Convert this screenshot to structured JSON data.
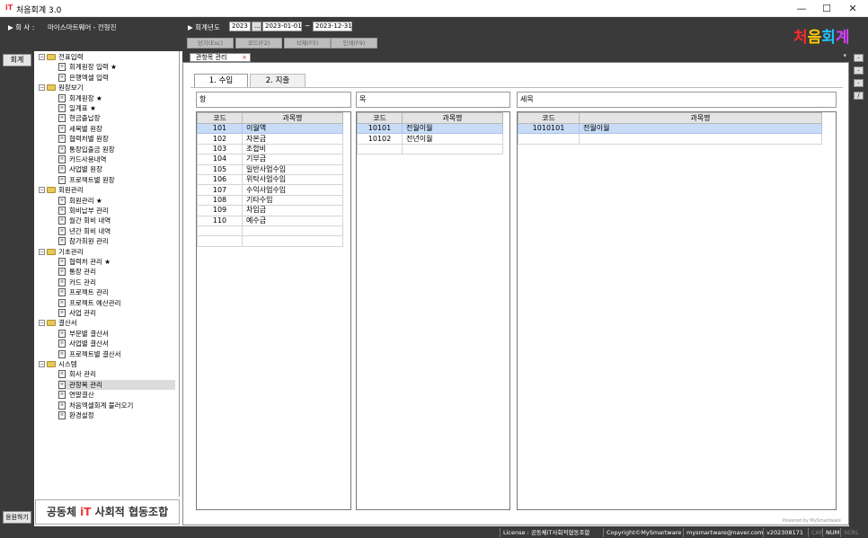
{
  "titlebar": {
    "title": "처음회계 3.0",
    "minimize": "—",
    "maximize": "☐",
    "close": "✕"
  },
  "header": {
    "company_label": "▶ 회 사 : ",
    "company_name": "마이스마트웨어 - 전형진",
    "fiscal_label": "▶ 회계년도",
    "year": "2023",
    "picker": "...",
    "date_from": "2023-01-01",
    "tilde": "~",
    "date_to": "2023-12-31",
    "buttons": {
      "close": "닫기(Esc)",
      "code": "코드(F2)",
      "delete": "삭제(F5)",
      "print": "인쇄(F9)"
    },
    "logo": [
      "처",
      "음",
      "회",
      "계"
    ],
    "logo_colors": [
      "#ff2a2a",
      "#ffcc00",
      "#22c1ff",
      "#d040ff"
    ]
  },
  "leftbar": {
    "tab_accounting": "회계",
    "support_button": "응원하기"
  },
  "tree": {
    "nodes": [
      {
        "label": "전표입력",
        "type": "folder"
      },
      {
        "label": "회계원장 입력 ★",
        "type": "item"
      },
      {
        "label": "은행엑셀 입력",
        "type": "item"
      },
      {
        "label": "원장보기",
        "type": "folder"
      },
      {
        "label": "회계원장 ★",
        "type": "item"
      },
      {
        "label": "일계표 ★",
        "type": "item"
      },
      {
        "label": "현금출납장",
        "type": "item"
      },
      {
        "label": "세목별 원장",
        "type": "item"
      },
      {
        "label": "협력처별 원장",
        "type": "item"
      },
      {
        "label": "통장입출금 원장",
        "type": "item"
      },
      {
        "label": "카드사용내역",
        "type": "item"
      },
      {
        "label": "사업별 원장",
        "type": "item"
      },
      {
        "label": "프로젝트별 원장",
        "type": "item"
      },
      {
        "label": "회원관리",
        "type": "folder"
      },
      {
        "label": "회원관리 ★",
        "type": "item"
      },
      {
        "label": "회비납부 관리",
        "type": "item"
      },
      {
        "label": "월간 회비 내역",
        "type": "item"
      },
      {
        "label": "년간 회비 내역",
        "type": "item"
      },
      {
        "label": "참가회원 관리",
        "type": "item"
      },
      {
        "label": "기초관리",
        "type": "folder"
      },
      {
        "label": "협력처 관리 ★",
        "type": "item"
      },
      {
        "label": "통장 관리",
        "type": "item"
      },
      {
        "label": "카드 관리",
        "type": "item"
      },
      {
        "label": "프로젝트 관리",
        "type": "item"
      },
      {
        "label": "프로젝트 예산관리",
        "type": "item"
      },
      {
        "label": "사업 관리",
        "type": "item"
      },
      {
        "label": "결산서",
        "type": "folder"
      },
      {
        "label": "부문별 결산서",
        "type": "item"
      },
      {
        "label": "사업별 결산서",
        "type": "item"
      },
      {
        "label": "프로젝트별 결산서",
        "type": "item"
      },
      {
        "label": "시스템",
        "type": "folder"
      },
      {
        "label": "회사 관리",
        "type": "item"
      },
      {
        "label": "관항목 관리",
        "type": "item",
        "selected": true
      },
      {
        "label": "연말결산",
        "type": "item"
      },
      {
        "label": "처음엑셀회계 불러오기",
        "type": "item"
      },
      {
        "label": "환경설정",
        "type": "item"
      }
    ]
  },
  "banner": {
    "pre": "공동체 ",
    "it": "iT",
    "post": " 사회적 협동조합"
  },
  "doc_tab": {
    "label": "관항목 관리",
    "close": "×"
  },
  "right_buttons": [
    "-",
    "-",
    "-",
    "/"
  ],
  "subtabs": [
    "1. 수입",
    "2. 지출"
  ],
  "sections": {
    "hang": "항",
    "mok": "목",
    "semok": "세목"
  },
  "grid_headers": {
    "code": "코드",
    "name": "과목명"
  },
  "hang_rows": [
    {
      "code": "101",
      "name": "이월액"
    },
    {
      "code": "102",
      "name": "자본금"
    },
    {
      "code": "103",
      "name": "조합비"
    },
    {
      "code": "104",
      "name": "기부금"
    },
    {
      "code": "105",
      "name": "일반사업수입"
    },
    {
      "code": "106",
      "name": "위탁사업수입"
    },
    {
      "code": "107",
      "name": "수익사업수입"
    },
    {
      "code": "108",
      "name": "기타수입"
    },
    {
      "code": "109",
      "name": "차입금"
    },
    {
      "code": "110",
      "name": "예수금"
    }
  ],
  "mok_rows": [
    {
      "code": "10101",
      "name": "전월이월"
    },
    {
      "code": "10102",
      "name": "전년이월"
    }
  ],
  "semok_rows": [
    {
      "code": "1010101",
      "name": "전월이월"
    }
  ],
  "powered": "Powered by MySmartware",
  "statusbar": {
    "license": "License : 공동체iT사회적협동조합",
    "copyright": "Copyright©MySmartware",
    "email": "mysmartware@naver.com",
    "version": "v202308171",
    "cap": "CAP",
    "num": "NUM",
    "scrl": "SCRL"
  }
}
